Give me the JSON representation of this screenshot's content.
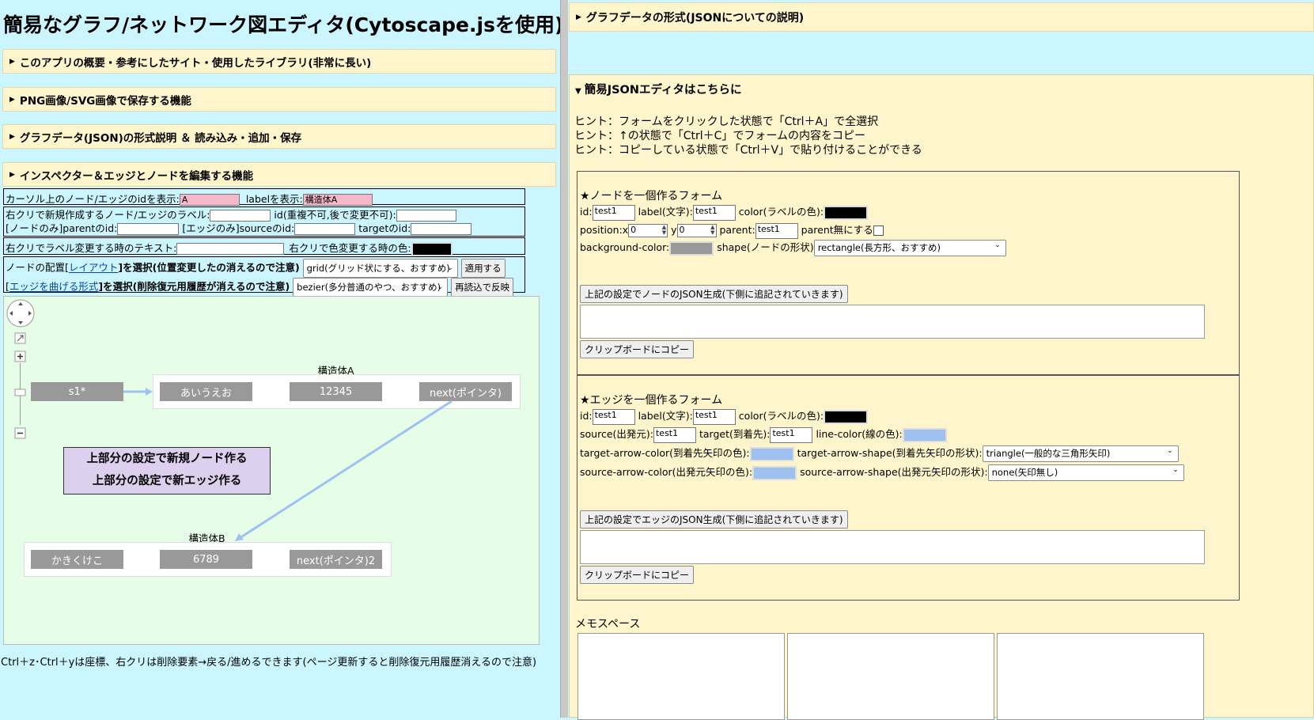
{
  "title": "簡易なグラフ/ネットワーク図エディタ(Cytoscape.jsを使用)",
  "accordions": [
    "このアプリの概要・参考にしたサイト・使用したライブラリ(非常に長い)",
    "PNG画像/SVG画像で保存する機能",
    "グラフデータ(JSON)の形式説明 ＆ 読み込み・追加・保存",
    "インスペクター＆エッジとノードを編集する機能"
  ],
  "inspector": {
    "cursor_label": "カーソル上のノード/エッジのidを表示:",
    "cursor_id": "A",
    "label_display": "labelを表示:",
    "label_value": "構造体A",
    "newlabel_label": "右クリで新規作成するノード/エッジのラベル:",
    "newid_label": "id(重複不可,後で変更不可):",
    "parent_label": "[ノードのみ]parentのid:",
    "source_label": "[エッジのみ]sourceのid:",
    "target_label": "targetのid:",
    "relabel_label": "右クリでラベル変更する時のテキスト:",
    "recolor_label": "右クリで色変更する時の色:",
    "layout_pre": "ノードの配置[",
    "layout_link": "レイアウト",
    "layout_post": "]を選択(位置変更したの消えるので注意)",
    "layout_value": "grid(グリッド状にする、おすすめ)",
    "layout_button": "適用する",
    "edge_pre": "[",
    "edge_link": "エッジを曲げる形式",
    "edge_post": "]を選択(削除復元用履歴が消えるので注意)",
    "edge_value": "bezier(多分普通のやつ、おすすめ)",
    "edge_button": "再読込で反映"
  },
  "graph": {
    "compoundA_label": "構造体A",
    "compoundB_label": "構造体B",
    "nodes": [
      "s1*",
      "あいうえお",
      "12345",
      "next(ポインタ)",
      "かきくけこ",
      "6789",
      "next(ポインタ)2"
    ],
    "note_line1": "上部分の設定で新規ノード作る",
    "note_line2": "上部分の設定で新エッジ作る",
    "edge_color": "#9fc1f0"
  },
  "footer": "Ctrl＋z･Ctrl＋yは座標、右クリは削除要素→戻る/進めるできます(ページ更新すると削除復元用履歴消えるので注意)",
  "right": {
    "json_format_title": "グラフデータの形式(JSONについての説明)",
    "json_editor_title": "簡易JSONエディタはこちらに",
    "hint1": "ヒント：フォームをクリックした状態で「Ctrl＋A」で全選択",
    "hint2": "ヒント：↑の状態で「Ctrl＋C」でフォームの内容をコピー",
    "hint3": "ヒント：コピーしている状態で「Ctrl＋V」で貼り付けることができる",
    "node_form": {
      "heading": "★ノードを一個作るフォーム",
      "id_label": "id:",
      "id_value": "test1",
      "label_label": "label(文字):",
      "label_value": "test1",
      "color_label": "color(ラベルの色):",
      "position_label": "position:x",
      "x_value": "0",
      "y_label": "y",
      "y_value": "0",
      "parent_label": "parent:",
      "parent_value": "test1",
      "noparent_label": "parent無にする",
      "bg_label": "background-color:",
      "shape_label": "shape(ノードの形状)",
      "shape_value": "rectangle(長方形、おすすめ)",
      "gen_button": "上記の設定でノードのJSON生成(下側に追記されていきます)",
      "copy_button": "クリップボードにコピー"
    },
    "edge_form": {
      "heading": "★エッジを一個作るフォーム",
      "id_label": "id:",
      "id_value": "test1",
      "label_label": "label(文字):",
      "label_value": "test1",
      "color_label": "color(ラベルの色):",
      "source_label": "source(出発元):",
      "source_value": "test1",
      "target_label": "target(到着先):",
      "target_value": "test1",
      "line_color_label": "line-color(線の色):",
      "tac_label": "target-arrow-color(到着先矢印の色):",
      "tas_label": "target-arrow-shape(到着先矢印の形状):",
      "tas_value": "triangle(一般的な三角形矢印)",
      "sac_label": "source-arrow-color(出発元矢印の色):",
      "sas_label": "source-arrow-shape(出発元矢印の形状):",
      "sas_value": "none(矢印無し)",
      "gen_button": "上記の設定でエッジのJSON生成(下側に追記されていきます)",
      "copy_button": "クリップボードにコピー"
    },
    "memo_label": "メモスペース"
  }
}
